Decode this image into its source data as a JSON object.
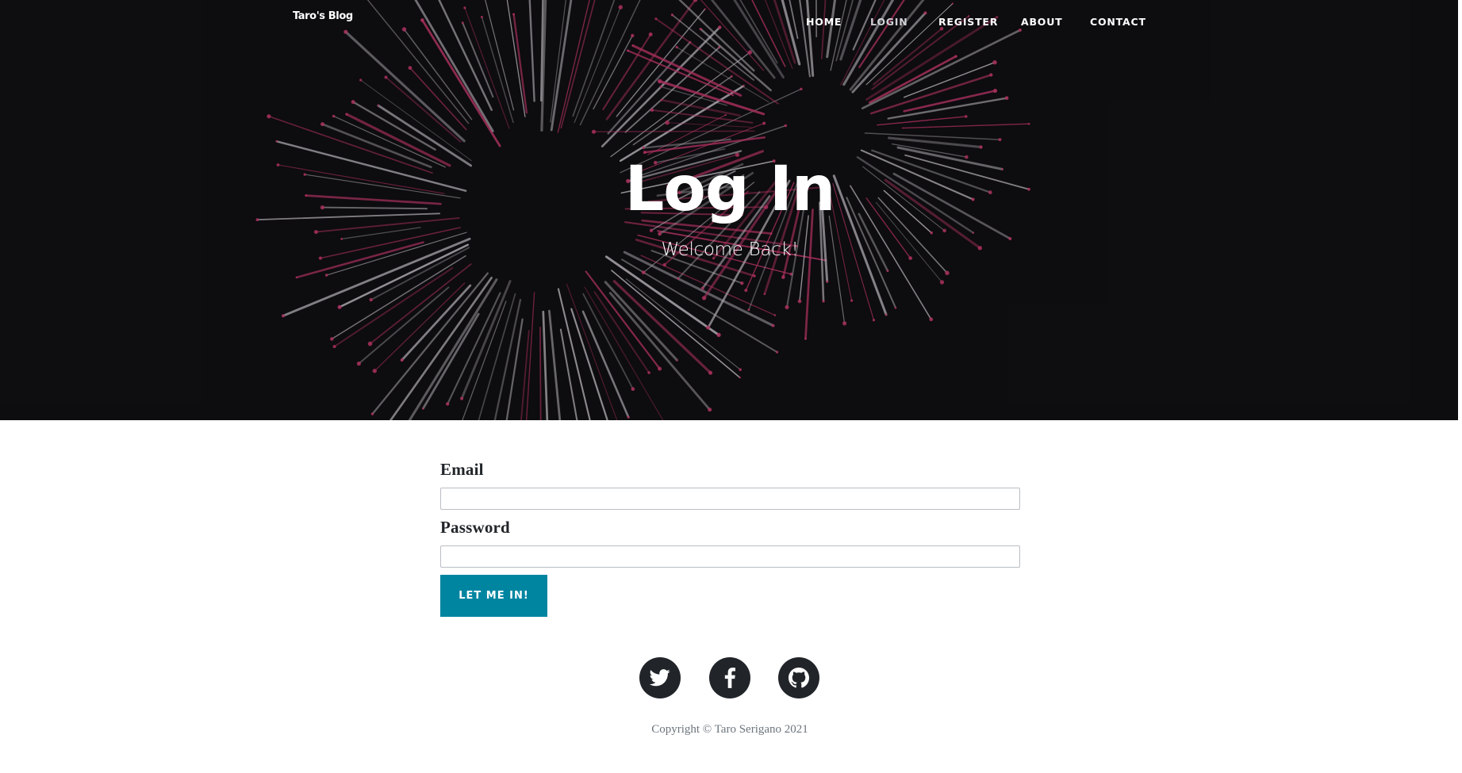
{
  "brand": {
    "name": "Taro's Blog"
  },
  "nav": {
    "items": [
      {
        "label": "HOME",
        "active": false
      },
      {
        "label": "LOGIN",
        "active": true
      },
      {
        "label": "REGISTER",
        "active": false
      },
      {
        "label": "ABOUT",
        "active": false
      },
      {
        "label": "CONTACT",
        "active": false
      }
    ]
  },
  "hero": {
    "heading": "Log In",
    "subheading": "Welcome Back!",
    "background": "fireworks-image"
  },
  "form": {
    "email_label": "Email",
    "email_value": "",
    "password_label": "Password",
    "password_value": "",
    "submit_label": "LET ME IN!"
  },
  "footer": {
    "social": [
      {
        "icon": "twitter-icon"
      },
      {
        "icon": "facebook-icon"
      },
      {
        "icon": "github-icon"
      }
    ],
    "copyright": "Copyright © Taro Serigano 2021"
  },
  "colors": {
    "accent": "#0085a1",
    "hero_bg": "#121114",
    "text_dark": "#212529",
    "text_muted": "#6c757d",
    "firework_pink": "#e0407a",
    "firework_light": "#e8e2ea"
  }
}
